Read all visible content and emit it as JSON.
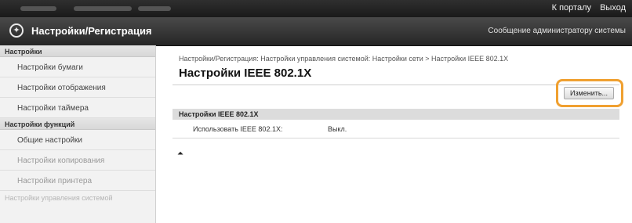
{
  "header": {
    "portal_link": "К порталу",
    "logout_link": "Выход",
    "app_title": "Настройки/Регистрация",
    "admin_message_link": "Сообщение администратору системы",
    "settings_icon": "gear-icon"
  },
  "sidebar": {
    "group1_title": "Настройки",
    "group1_items": [
      {
        "label": "Настройки бумаги"
      },
      {
        "label": "Настройки отображения"
      },
      {
        "label": "Настройки таймера"
      }
    ],
    "group2_title": "Настройки функций",
    "group2_items": [
      {
        "label": "Общие настройки"
      },
      {
        "label": "Настройки копирования"
      },
      {
        "label": "Настройки принтера"
      }
    ],
    "faded_item": "Настройки управления системой"
  },
  "main": {
    "breadcrumb": "Настройки/Регистрация: Настройки управления системой: Настройки сети > Настройки IEEE 802.1X",
    "title": "Настройки IEEE 802.1X",
    "edit_button": "Изменить...",
    "section_title": "Настройки IEEE 802.1X",
    "rows": [
      {
        "label": "Использовать IEEE 802.1X:",
        "value": "Выкл."
      }
    ],
    "back_to_top_icon": "back-to-top-icon",
    "back_to_top_glyph": "⏶"
  },
  "colors": {
    "highlight": "#f0a030",
    "topbar": "#1a1a1a",
    "titlebar": "#262626"
  }
}
